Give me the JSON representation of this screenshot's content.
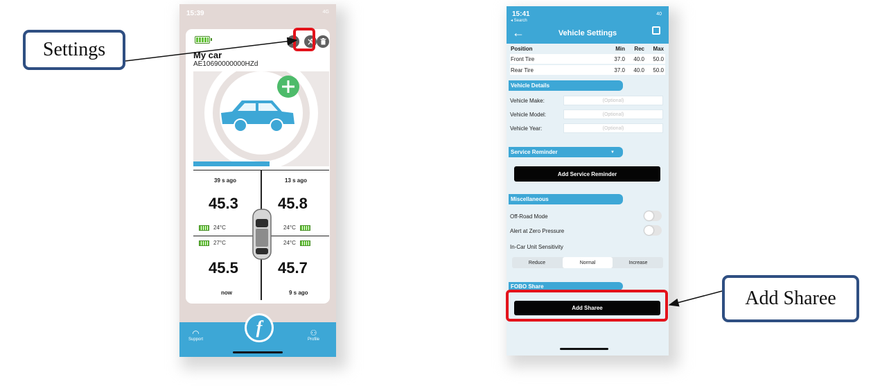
{
  "callouts": {
    "settings": "Settings",
    "add_sharee": "Add Sharee"
  },
  "phone1": {
    "status_time": "15:39",
    "status_right": "4G",
    "car_name": "My car",
    "car_id": "AE10690000000HZd",
    "tires": [
      {
        "ago": "39 s ago",
        "pressure": "45.3",
        "temp": "24°C"
      },
      {
        "ago": "13 s ago",
        "pressure": "45.8",
        "temp": "24°C"
      },
      {
        "ago": "now",
        "pressure": "45.5",
        "temp": "27°C"
      },
      {
        "ago": "9 s ago",
        "pressure": "45.7",
        "temp": "24°C"
      }
    ],
    "tabs": {
      "support": "Support",
      "logo": "f",
      "profile": "Profile"
    },
    "colors": {
      "accent": "#3da7d6",
      "highlight": "#e3131b"
    }
  },
  "phone2": {
    "status_time": "15:41",
    "status_search": "◂ Search",
    "status_right": "40",
    "title": "Vehicle Settings",
    "table": {
      "headers": [
        "Position",
        "Min",
        "Rec",
        "Max"
      ],
      "rows": [
        [
          "Front Tire",
          "37.0",
          "40.0",
          "50.0"
        ],
        [
          "Rear Tire",
          "37.0",
          "40.0",
          "50.0"
        ]
      ]
    },
    "vehicle_details": {
      "section": "Vehicle Details",
      "make_label": "Vehicle Make:",
      "model_label": "Vehicle Model:",
      "year_label": "Vehicle Year:",
      "placeholder": "(Optional)"
    },
    "service": {
      "section": "Service Reminder",
      "add_button": "Add Service Reminder"
    },
    "misc": {
      "section": "Miscellaneous",
      "off_road": "Off-Road Mode",
      "alert_zero": "Alert at Zero Pressure",
      "sensitivity": "In-Car Unit Sensitivity",
      "options": [
        "Reduce",
        "Normal",
        "Increase"
      ],
      "selected": "Normal"
    },
    "share": {
      "section": "FOBO Share",
      "add_button": "Add Sharee"
    }
  }
}
